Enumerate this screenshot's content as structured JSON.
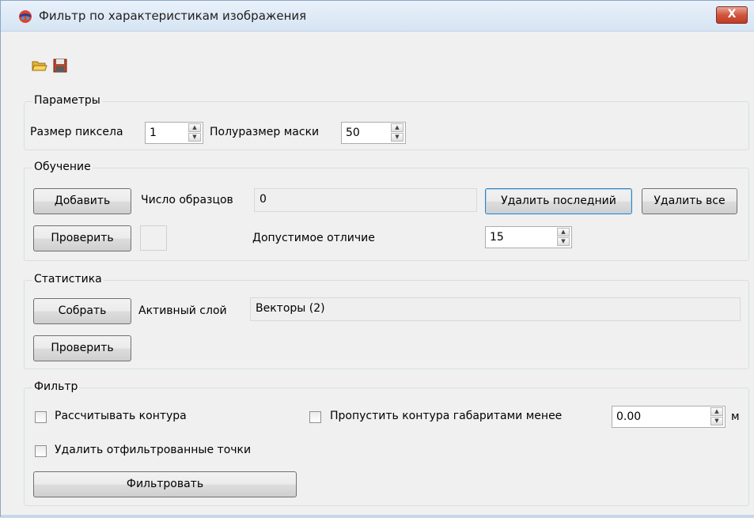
{
  "window": {
    "title": "Фильтр по характеристикам изображения",
    "app_icon": "colorful-globe-icon",
    "close_label": "X"
  },
  "toolbar": {
    "open_icon": "folder-open-icon",
    "save_icon": "floppy-save-icon"
  },
  "params": {
    "title": "Параметры",
    "pixel_size_label": "Размер пиксела",
    "pixel_size_value": "1",
    "mask_half_size_label": "Полуразмер маски",
    "mask_half_size_value": "50"
  },
  "training": {
    "title": "Обучение",
    "add_label": "Добавить",
    "samples_label": "Число образцов",
    "samples_value": "0",
    "remove_last_label": "Удалить последний",
    "remove_all_label": "Удалить все",
    "check_label": "Проверить",
    "tolerance_label": "Допустимое отличие",
    "tolerance_value": "15"
  },
  "stats": {
    "title": "Статистика",
    "collect_label": "Собрать",
    "active_layer_label": "Активный слой",
    "active_layer_value": "Векторы (2)",
    "check_label": "Проверить"
  },
  "filter": {
    "title": "Фильтр",
    "compute_contours_label": "Рассчитывать контура",
    "compute_contours_checked": false,
    "skip_contours_label": "Пропустить контура габаритами менее",
    "skip_contours_checked": false,
    "min_size_value": "0.00",
    "min_size_unit": "м",
    "delete_filtered_label": "Удалить отфильтрованные точки",
    "delete_filtered_checked": false,
    "run_label": "Фильтровать"
  },
  "colors": {
    "title_bar": "#dbe7f4",
    "close_button": "#c94a33",
    "dialog_bg": "#f0f0f0",
    "focus_border": "#3c7fb1"
  }
}
